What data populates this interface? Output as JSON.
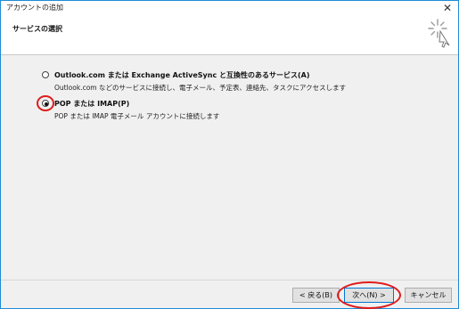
{
  "window": {
    "title": "アカウントの追加",
    "close_glyph": "✕"
  },
  "header": {
    "section_title": "サービスの選択",
    "icon": "wizard-sparkle-icon"
  },
  "options": [
    {
      "label": "Outlook.com または Exchange ActiveSync と互換性のあるサービス(A)",
      "description": "Outlook.com などのサービスに接続し、電子メール、予定表、連絡先、タスクにアクセスします",
      "selected": false
    },
    {
      "label": "POP または IMAP(P)",
      "description": "POP または IMAP 電子メール アカウントに接続します",
      "selected": true
    }
  ],
  "buttons": {
    "back": "< 戻る(B)",
    "next": "次へ(N) >",
    "cancel": "キャンセル"
  },
  "colors": {
    "annotation": "#e01b1b",
    "window_border": "#1f8bd6",
    "accent": "#0078d7"
  }
}
